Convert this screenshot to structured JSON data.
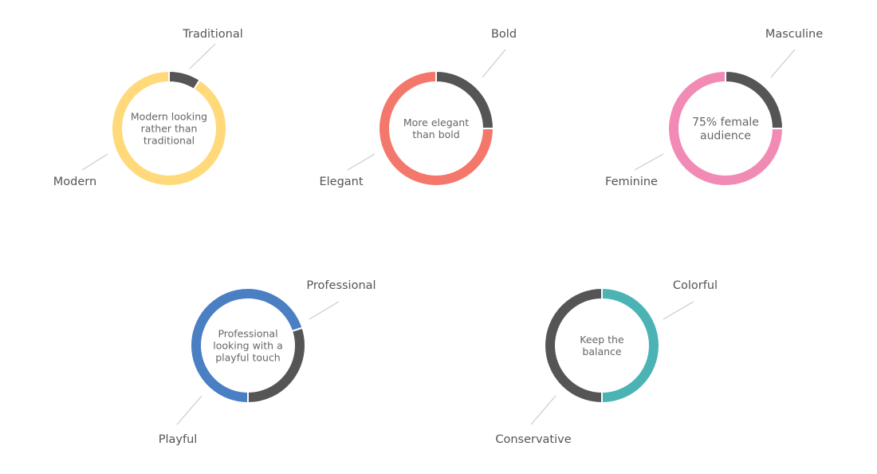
{
  "chart_data": [
    {
      "type": "pie",
      "center_text": [
        "Modern looking",
        "rather than",
        "traditional"
      ],
      "slices": [
        {
          "label": "Traditional",
          "value": 9,
          "color": "#555555"
        },
        {
          "label": "Modern",
          "value": 91,
          "color": "#FFD97A"
        }
      ]
    },
    {
      "type": "pie",
      "center_text": [
        "More elegant",
        "than bold"
      ],
      "slices": [
        {
          "label": "Bold",
          "value": 25,
          "color": "#555555"
        },
        {
          "label": "Elegant",
          "value": 75,
          "color": "#F4776C"
        }
      ]
    },
    {
      "type": "pie",
      "center_text": [
        "75% female",
        "audience"
      ],
      "slices": [
        {
          "label": "Masculine",
          "value": 25,
          "color": "#555555"
        },
        {
          "label": "Feminine",
          "value": 75,
          "color": "#F18BB5"
        }
      ]
    },
    {
      "type": "pie",
      "center_text": [
        "Professional",
        "looking with a",
        "playful touch"
      ],
      "slices": [
        {
          "label": "Professional",
          "value": 70,
          "color": "#4A7FC4"
        },
        {
          "label": "Playful",
          "value": 30,
          "color": "#555555"
        }
      ]
    },
    {
      "type": "pie",
      "center_text": [
        "Keep the",
        "balance"
      ],
      "slices": [
        {
          "label": "Colorful",
          "value": 50,
          "color": "#4BB3B3"
        },
        {
          "label": "Conservative",
          "value": 50,
          "color": "#555555"
        }
      ]
    }
  ]
}
